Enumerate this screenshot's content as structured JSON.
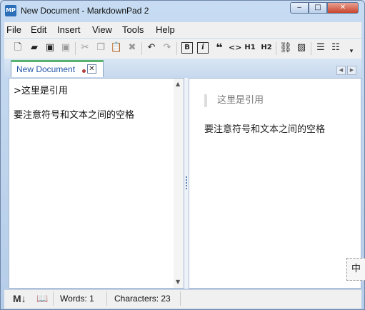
{
  "window": {
    "app_icon_text": "MP",
    "title": "New Document - MarkdownPad 2",
    "controls": {
      "minimize": "‒",
      "maximize": "□",
      "close": "✕"
    }
  },
  "menu": [
    {
      "label": "File",
      "name": "menu-file"
    },
    {
      "label": "Edit",
      "name": "menu-edit"
    },
    {
      "label": "Insert",
      "name": "menu-insert"
    },
    {
      "label": "View",
      "name": "menu-view"
    },
    {
      "label": "Tools",
      "name": "menu-tools"
    },
    {
      "label": "Help",
      "name": "menu-help"
    }
  ],
  "toolbar": {
    "icons": [
      "new-document-icon",
      "open-folder-icon",
      "save-icon",
      "save-all-icon",
      "cut-icon",
      "copy-icon",
      "paste-icon",
      "delete-icon",
      "undo-icon",
      "redo-icon",
      "bold-icon",
      "italic-icon",
      "quote-icon",
      "code-icon",
      "heading1-icon",
      "heading2-icon",
      "link-icon",
      "image-icon",
      "bulleted-list-icon",
      "numbered-list-icon",
      "overflow-icon"
    ],
    "bold_label": "B",
    "italic_label": "i",
    "code_label": "<>",
    "h1_label": "H1",
    "h2_label": "H2"
  },
  "tab": {
    "label": "New Document",
    "close": "✕"
  },
  "editor": {
    "lines": [
      ">这里是引用",
      "要注意符号和文本之间的空格"
    ]
  },
  "preview": {
    "blockquote": "这里是引用",
    "paragraph": "要注意符号和文本之间的空格"
  },
  "ime_indicator": "中",
  "status": {
    "words_label": "Words: 1",
    "characters_label": "Characters: 23"
  }
}
